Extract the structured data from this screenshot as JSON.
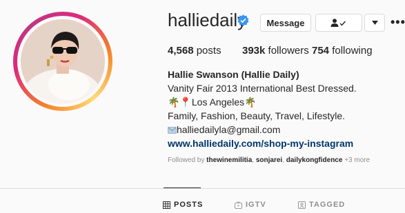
{
  "profile": {
    "username": "halliedaily",
    "message_label": "Message"
  },
  "stats": {
    "posts_count": "4,568",
    "posts_label": "posts",
    "followers_count": "393k",
    "followers_label": "followers",
    "following_count": "754",
    "following_label": "following"
  },
  "bio": {
    "name": "Hallie Swanson (Hallie Daily)",
    "line1": "Vanity Fair 2013 International Best Dressed.",
    "line2_prefix": "🌴📍",
    "line2_text": "Los Angeles",
    "line2_suffix": "🌴",
    "line3": "Family, Fashion, Beauty, Travel, Lifestyle.",
    "email": "halliedailyla@gmail.com",
    "website": "www.halliedaily.com/shop-my-instagram"
  },
  "followed_by": {
    "prefix": "Followed by",
    "users": [
      "thewinemilitia",
      "sonjarei",
      "dailykongfidence"
    ],
    "more": "+3 more"
  },
  "tabs": [
    {
      "label": "POSTS",
      "icon": "grid-icon",
      "active": true
    },
    {
      "label": "IGTV",
      "icon": "igtv-icon",
      "active": false
    },
    {
      "label": "TAGGED",
      "icon": "tagged-icon",
      "active": false
    }
  ],
  "colors": {
    "link": "#00376b",
    "verified": "#3897f0",
    "muted": "#8e8e8e"
  }
}
